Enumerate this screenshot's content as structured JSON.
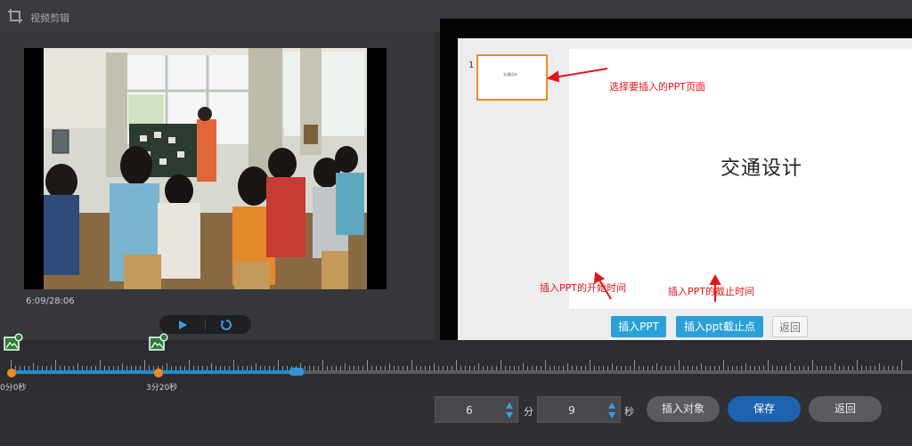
{
  "window": {
    "title": "视频剪辑",
    "app_icon": "crop-frame-icon"
  },
  "video": {
    "time_readout": "6:09/28:06",
    "controls": {
      "play_icon": "play-icon",
      "replay_icon": "replay-icon"
    }
  },
  "ppt": {
    "thumbnails": [
      {
        "number": "1",
        "text": "交通设计",
        "selected": true
      }
    ],
    "slide_title": "交通设计",
    "annotations": {
      "select_page": "选择要插入的PPT页面",
      "start_time": "插入PPT的开始时间",
      "end_time": "插入PPT的截止时间"
    },
    "buttons": {
      "insert_ppt": "插入PPT",
      "insert_end": "插入ppt截止点",
      "back": "返回"
    },
    "colors": {
      "accent": "#2aa1d6",
      "annotation": "#e3151a",
      "thumbnail_border": "#f08a20"
    }
  },
  "timeline": {
    "progress_fraction": 0.322,
    "markers": [
      {
        "label": "0分0秒",
        "icon": "image-marker-icon"
      },
      {
        "label": "3分20秒",
        "icon": "image-marker-icon"
      }
    ],
    "colors": {
      "fill": "#1d8fd0",
      "marker": "#f08a20"
    }
  },
  "bottom": {
    "minutes_value": "6",
    "minutes_unit": "分",
    "seconds_value": "9",
    "seconds_unit": "秒",
    "insert_object": "插入对象",
    "save": "保存",
    "back": "返回",
    "colors": {
      "save": "#1d63b0"
    }
  }
}
